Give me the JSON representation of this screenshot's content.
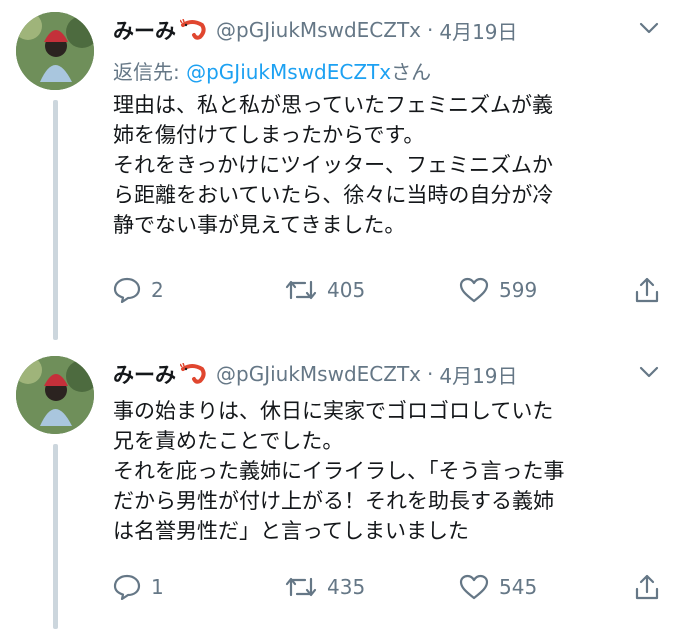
{
  "tweets": [
    {
      "name": "みーみ",
      "handle": "@pGJiukMswdECZTx",
      "separator": "·",
      "date": "4月19日",
      "reply_prefix": "返信先: ",
      "reply_mention": "@pGJiukMswdECZTx",
      "reply_suffix": "さん",
      "lines": [
        "理由は、私と私が思っていたフェミニズムが義",
        "姉を傷付けてしまったからです。",
        "それをきっかけにツイッター、フェミニズムか",
        "ら距離をおいていたら、徐々に当時の自分が冷",
        "静でない事が見えてきました。"
      ],
      "replies": "2",
      "retweets": "405",
      "likes": "599"
    },
    {
      "name": "みーみ",
      "handle": "@pGJiukMswdECZTx",
      "separator": "·",
      "date": "4月19日",
      "lines": [
        "事の始まりは、休日に実家でゴロゴロしていた",
        "兄を責めたことでした。",
        "それを庇った義姉にイライラし、「そう言った事",
        "だから男性が付け上がる！それを助長する義姉",
        "は名誉男性だ」と言ってしまいました"
      ],
      "replies": "1",
      "retweets": "435",
      "likes": "545"
    }
  ],
  "icons": [
    "shrimp-emoji-icon",
    "chevron-down-icon",
    "reply-icon",
    "retweet-icon",
    "like-icon",
    "share-icon"
  ],
  "colors": {
    "secondary_text": "#657786",
    "link": "#1da1f2",
    "thread_line": "#ccd6dd"
  }
}
